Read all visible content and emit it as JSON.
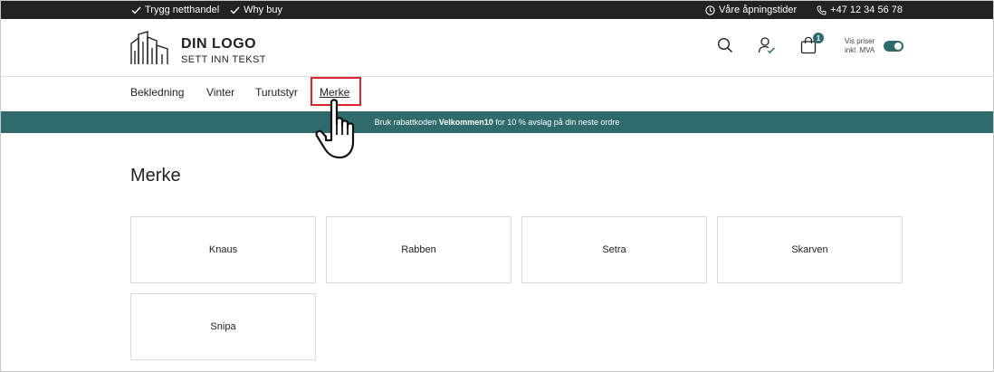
{
  "topbar": {
    "trust_label": "Trygg netthandel",
    "why_label": "Why buy",
    "hours_label": "Våre åpningstider",
    "phone_label": "+47 12 34 56 78",
    "icons": [
      "check-icon",
      "check-icon",
      "clock-icon",
      "phone-icon"
    ]
  },
  "header": {
    "logo_title": "DIN LOGO",
    "logo_subtitle": "SETT INN TEKST",
    "cart_count": "1",
    "vat_label_line1": "Vis priser",
    "vat_label_line2": "inkl. MVA",
    "vat_toggle_on": true,
    "icons": [
      "search-icon",
      "user-icon",
      "bag-icon"
    ]
  },
  "nav": {
    "items": [
      {
        "label": "Bekledning"
      },
      {
        "label": "Vinter"
      },
      {
        "label": "Turutstyr"
      },
      {
        "label": "Merke"
      }
    ],
    "active": "Merke"
  },
  "promo": {
    "prefix": "Bruk rabattkoden ",
    "code": "Velkommen10",
    "suffix": " for 10 % avslag på din neste ordre"
  },
  "main": {
    "title": "Merke",
    "brands": [
      {
        "label": "Knaus"
      },
      {
        "label": "Rabben"
      },
      {
        "label": "Setra"
      },
      {
        "label": "Skarven"
      },
      {
        "label": "Snipa"
      }
    ]
  },
  "colors": {
    "topbar_bg": "#222222",
    "accent": "#2e6b6a",
    "highlight": "#d9262e",
    "border": "#dcdcdc"
  }
}
